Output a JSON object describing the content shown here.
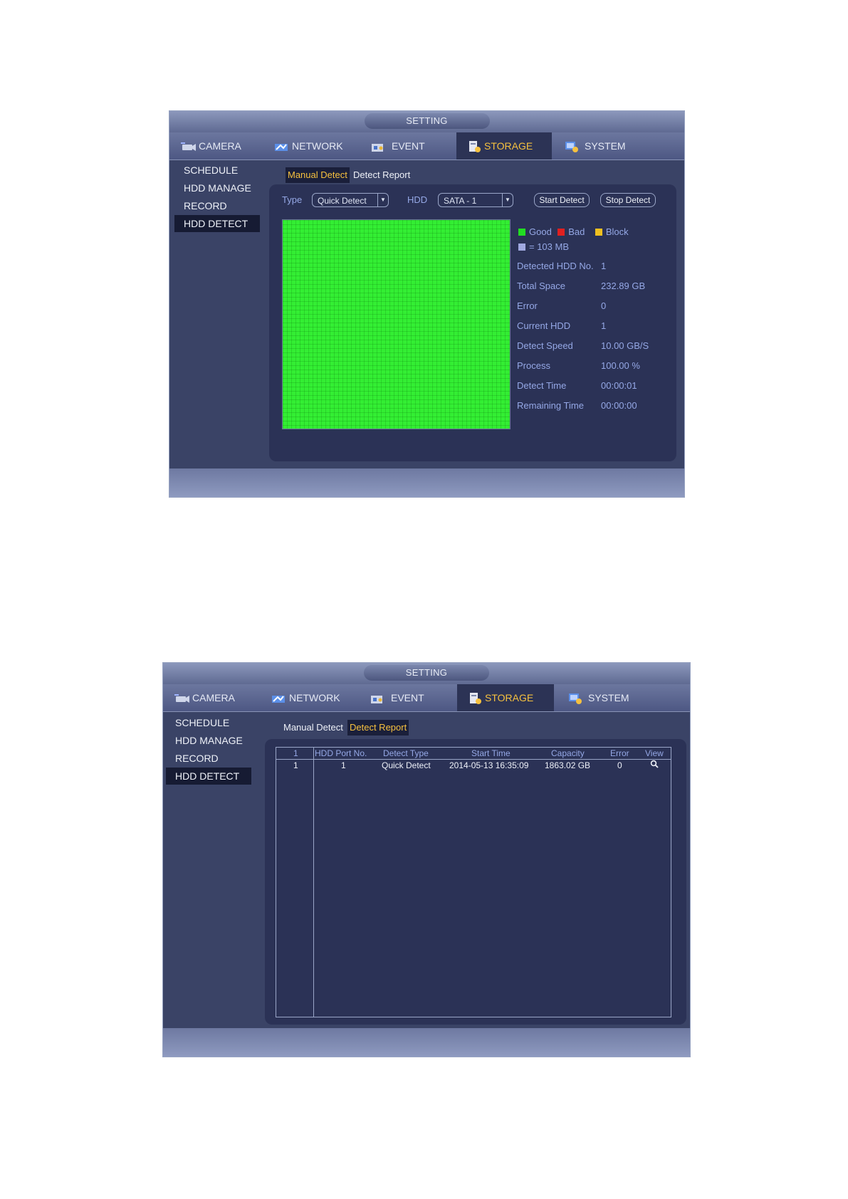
{
  "colors": {
    "good": "#22dd22",
    "bad": "#e02020",
    "block": "#f0c020",
    "unit": "#a0a8e0",
    "accent": "#f6c13f"
  },
  "window1": {
    "title": "SETTING",
    "tabs": [
      {
        "label": "CAMERA",
        "icon": "camera-icon"
      },
      {
        "label": "NETWORK",
        "icon": "network-icon"
      },
      {
        "label": "EVENT",
        "icon": "event-icon"
      },
      {
        "label": "STORAGE",
        "icon": "storage-icon"
      },
      {
        "label": "SYSTEM",
        "icon": "system-icon"
      }
    ],
    "active_tab": "STORAGE",
    "sidebar": [
      "SCHEDULE",
      "HDD MANAGE",
      "RECORD",
      "HDD DETECT"
    ],
    "active_side": "HDD DETECT",
    "subtabs": [
      "Manual Detect",
      "Detect Report"
    ],
    "active_subtab": "Manual Detect",
    "type_label": "Type",
    "type_value": "Quick Detect",
    "hdd_label": "HDD",
    "hdd_value": "SATA - 1",
    "start_button": "Start Detect",
    "stop_button": "Stop Detect",
    "legend": {
      "good": "Good",
      "bad": "Bad",
      "block": "Block",
      "unit": "= 103 MB"
    },
    "info": [
      {
        "key": "Detected HDD No.",
        "value": "1"
      },
      {
        "key": "Total Space",
        "value": "232.89 GB"
      },
      {
        "key": "Error",
        "value": "0"
      },
      {
        "key": "Current HDD",
        "value": "1"
      },
      {
        "key": "Detect Speed",
        "value": "10.00 GB/S"
      },
      {
        "key": "Process",
        "value": "100.00 %"
      },
      {
        "key": "Detect Time",
        "value": "00:00:01"
      },
      {
        "key": "Remaining Time",
        "value": "00:00:00"
      }
    ]
  },
  "window2": {
    "title": "SETTING",
    "tabs": [
      {
        "label": "CAMERA",
        "icon": "camera-icon"
      },
      {
        "label": "NETWORK",
        "icon": "network-icon"
      },
      {
        "label": "EVENT",
        "icon": "event-icon"
      },
      {
        "label": "STORAGE",
        "icon": "storage-icon"
      },
      {
        "label": "SYSTEM",
        "icon": "system-icon"
      }
    ],
    "active_tab": "STORAGE",
    "sidebar": [
      "SCHEDULE",
      "HDD MANAGE",
      "RECORD",
      "HDD DETECT"
    ],
    "active_side": "HDD DETECT",
    "subtabs": [
      "Manual Detect",
      "Detect Report"
    ],
    "active_subtab": "Detect Report",
    "table": {
      "headers": [
        "1",
        "HDD Port No.",
        "Detect Type",
        "Start Time",
        "Capacity",
        "Error",
        "View"
      ],
      "rows": [
        [
          "1",
          "1",
          "Quick Detect",
          "2014-05-13 16:35:09",
          "1863.02 GB",
          "0",
          "search-icon"
        ]
      ]
    }
  }
}
